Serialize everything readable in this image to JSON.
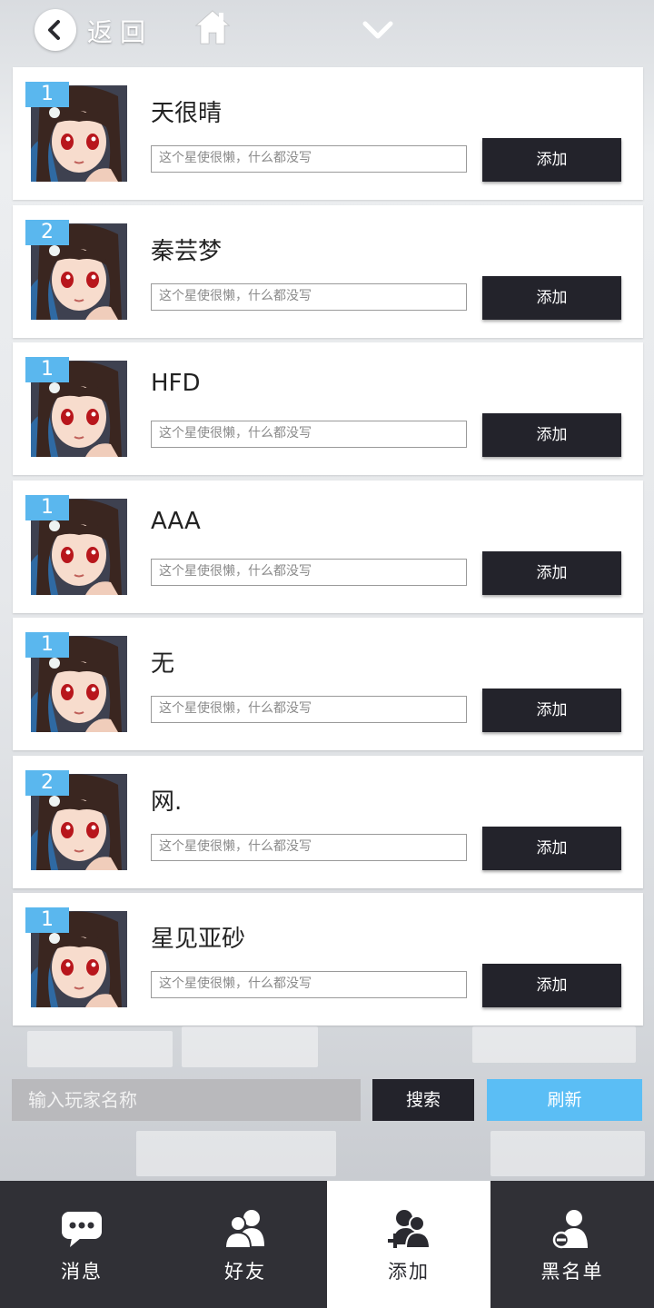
{
  "header": {
    "back_label": "返回"
  },
  "players": [
    {
      "level": "1",
      "name": "天很晴",
      "signature": "这个星使很懒，什么都没写",
      "add_label": "添加"
    },
    {
      "level": "2",
      "name": "秦芸梦",
      "signature": "这个星使很懒，什么都没写",
      "add_label": "添加"
    },
    {
      "level": "1",
      "name": "HFD",
      "signature": "这个星使很懒，什么都没写",
      "add_label": "添加"
    },
    {
      "level": "1",
      "name": "AAA",
      "signature": "这个星使很懒，什么都没写",
      "add_label": "添加"
    },
    {
      "level": "1",
      "name": "无",
      "signature": "这个星使很懒，什么都没写",
      "add_label": "添加"
    },
    {
      "level": "2",
      "name": "网.",
      "signature": "这个星使很懒，什么都没写",
      "add_label": "添加"
    },
    {
      "level": "1",
      "name": "星见亚砂",
      "signature": "这个星使很懒，什么都没写",
      "add_label": "添加"
    }
  ],
  "search": {
    "placeholder": "输入玩家名称",
    "search_label": "搜索",
    "refresh_label": "刷新"
  },
  "nav": {
    "tabs": [
      {
        "label": "消息",
        "icon": "chat-icon"
      },
      {
        "label": "好友",
        "icon": "friends-icon"
      },
      {
        "label": "添加",
        "icon": "add-friend-icon",
        "active": true
      },
      {
        "label": "黑名单",
        "icon": "blacklist-icon"
      }
    ]
  },
  "colors": {
    "accent": "#5bbef5",
    "dark_button": "#23232b",
    "nav_bg": "#303036",
    "badge": "#5ab7ee"
  }
}
